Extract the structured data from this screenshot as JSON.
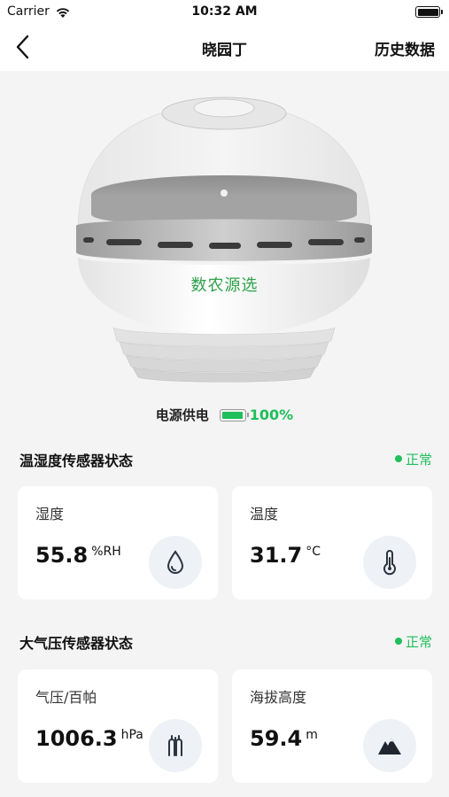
{
  "status_bar": {
    "carrier": "Carrier",
    "time": "10:32 AM"
  },
  "nav": {
    "title": "晓园丁",
    "right_label": "历史数据",
    "back_icon": "chevron-left-icon"
  },
  "device": {
    "brand_text": "数农源选"
  },
  "power": {
    "label": "电源供电",
    "value": "100%",
    "level": 1.0,
    "color": "#1fbf5a"
  },
  "sections": [
    {
      "title": "温湿度传感器状态",
      "status": "正常",
      "cards": [
        {
          "label": "湿度",
          "value": "55.8",
          "unit": "%RH",
          "icon": "water-drop-icon"
        },
        {
          "label": "温度",
          "value": "31.7",
          "unit": "°C",
          "icon": "thermometer-icon"
        }
      ]
    },
    {
      "title": "大气压传感器状态",
      "status": "正常",
      "cards": [
        {
          "label": "气压/百帕",
          "value": "1006.3",
          "unit": "hPa",
          "icon": "pressure-icon"
        },
        {
          "label": "海拔高度",
          "value": "59.4",
          "unit": "m",
          "icon": "mountain-icon"
        }
      ]
    }
  ],
  "colors": {
    "accent_green": "#1fbf5a",
    "icon_bg": "#eef1f6"
  }
}
